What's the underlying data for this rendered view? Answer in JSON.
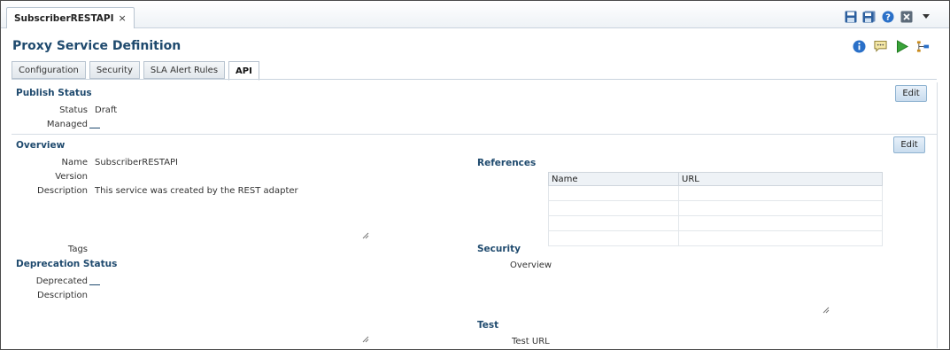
{
  "document_tab": {
    "label": "SubscriberRESTAPI",
    "close_glyph": "×"
  },
  "top_toolbar": {
    "icons": [
      "save-icon",
      "save-all-icon",
      "help-icon",
      "close-window-icon",
      "dropdown-caret-icon"
    ]
  },
  "page": {
    "title": "Proxy Service Definition"
  },
  "title_toolbar": {
    "icons": [
      "info-icon",
      "comment-icon",
      "run-icon",
      "flow-icon"
    ]
  },
  "tabs": [
    {
      "label": "Configuration",
      "active": false
    },
    {
      "label": "Security",
      "active": false
    },
    {
      "label": "SLA Alert Rules",
      "active": false
    },
    {
      "label": "API",
      "active": true
    }
  ],
  "publish_status": {
    "heading": "Publish Status",
    "edit_label": "Edit",
    "status_label": "Status",
    "status_value": "Draft",
    "managed_label": "Managed"
  },
  "overview": {
    "heading": "Overview",
    "edit_label": "Edit",
    "name_label": "Name",
    "name_value": "SubscriberRESTAPI",
    "version_label": "Version",
    "description_label": "Description",
    "description_value": "This service was created by the REST adapter",
    "tags_label": "Tags"
  },
  "deprecation_status": {
    "heading": "Deprecation Status",
    "deprecated_label": "Deprecated",
    "description_label": "Description"
  },
  "references": {
    "heading": "References",
    "columns": [
      "Name",
      "URL"
    ]
  },
  "security": {
    "heading": "Security",
    "overview_label": "Overview"
  },
  "test": {
    "heading": "Test",
    "test_url_label": "Test URL"
  },
  "colors": {
    "heading_blue": "#1f4a6e",
    "accent_blue": "#2a70c8",
    "run_green": "#3aa33a"
  }
}
